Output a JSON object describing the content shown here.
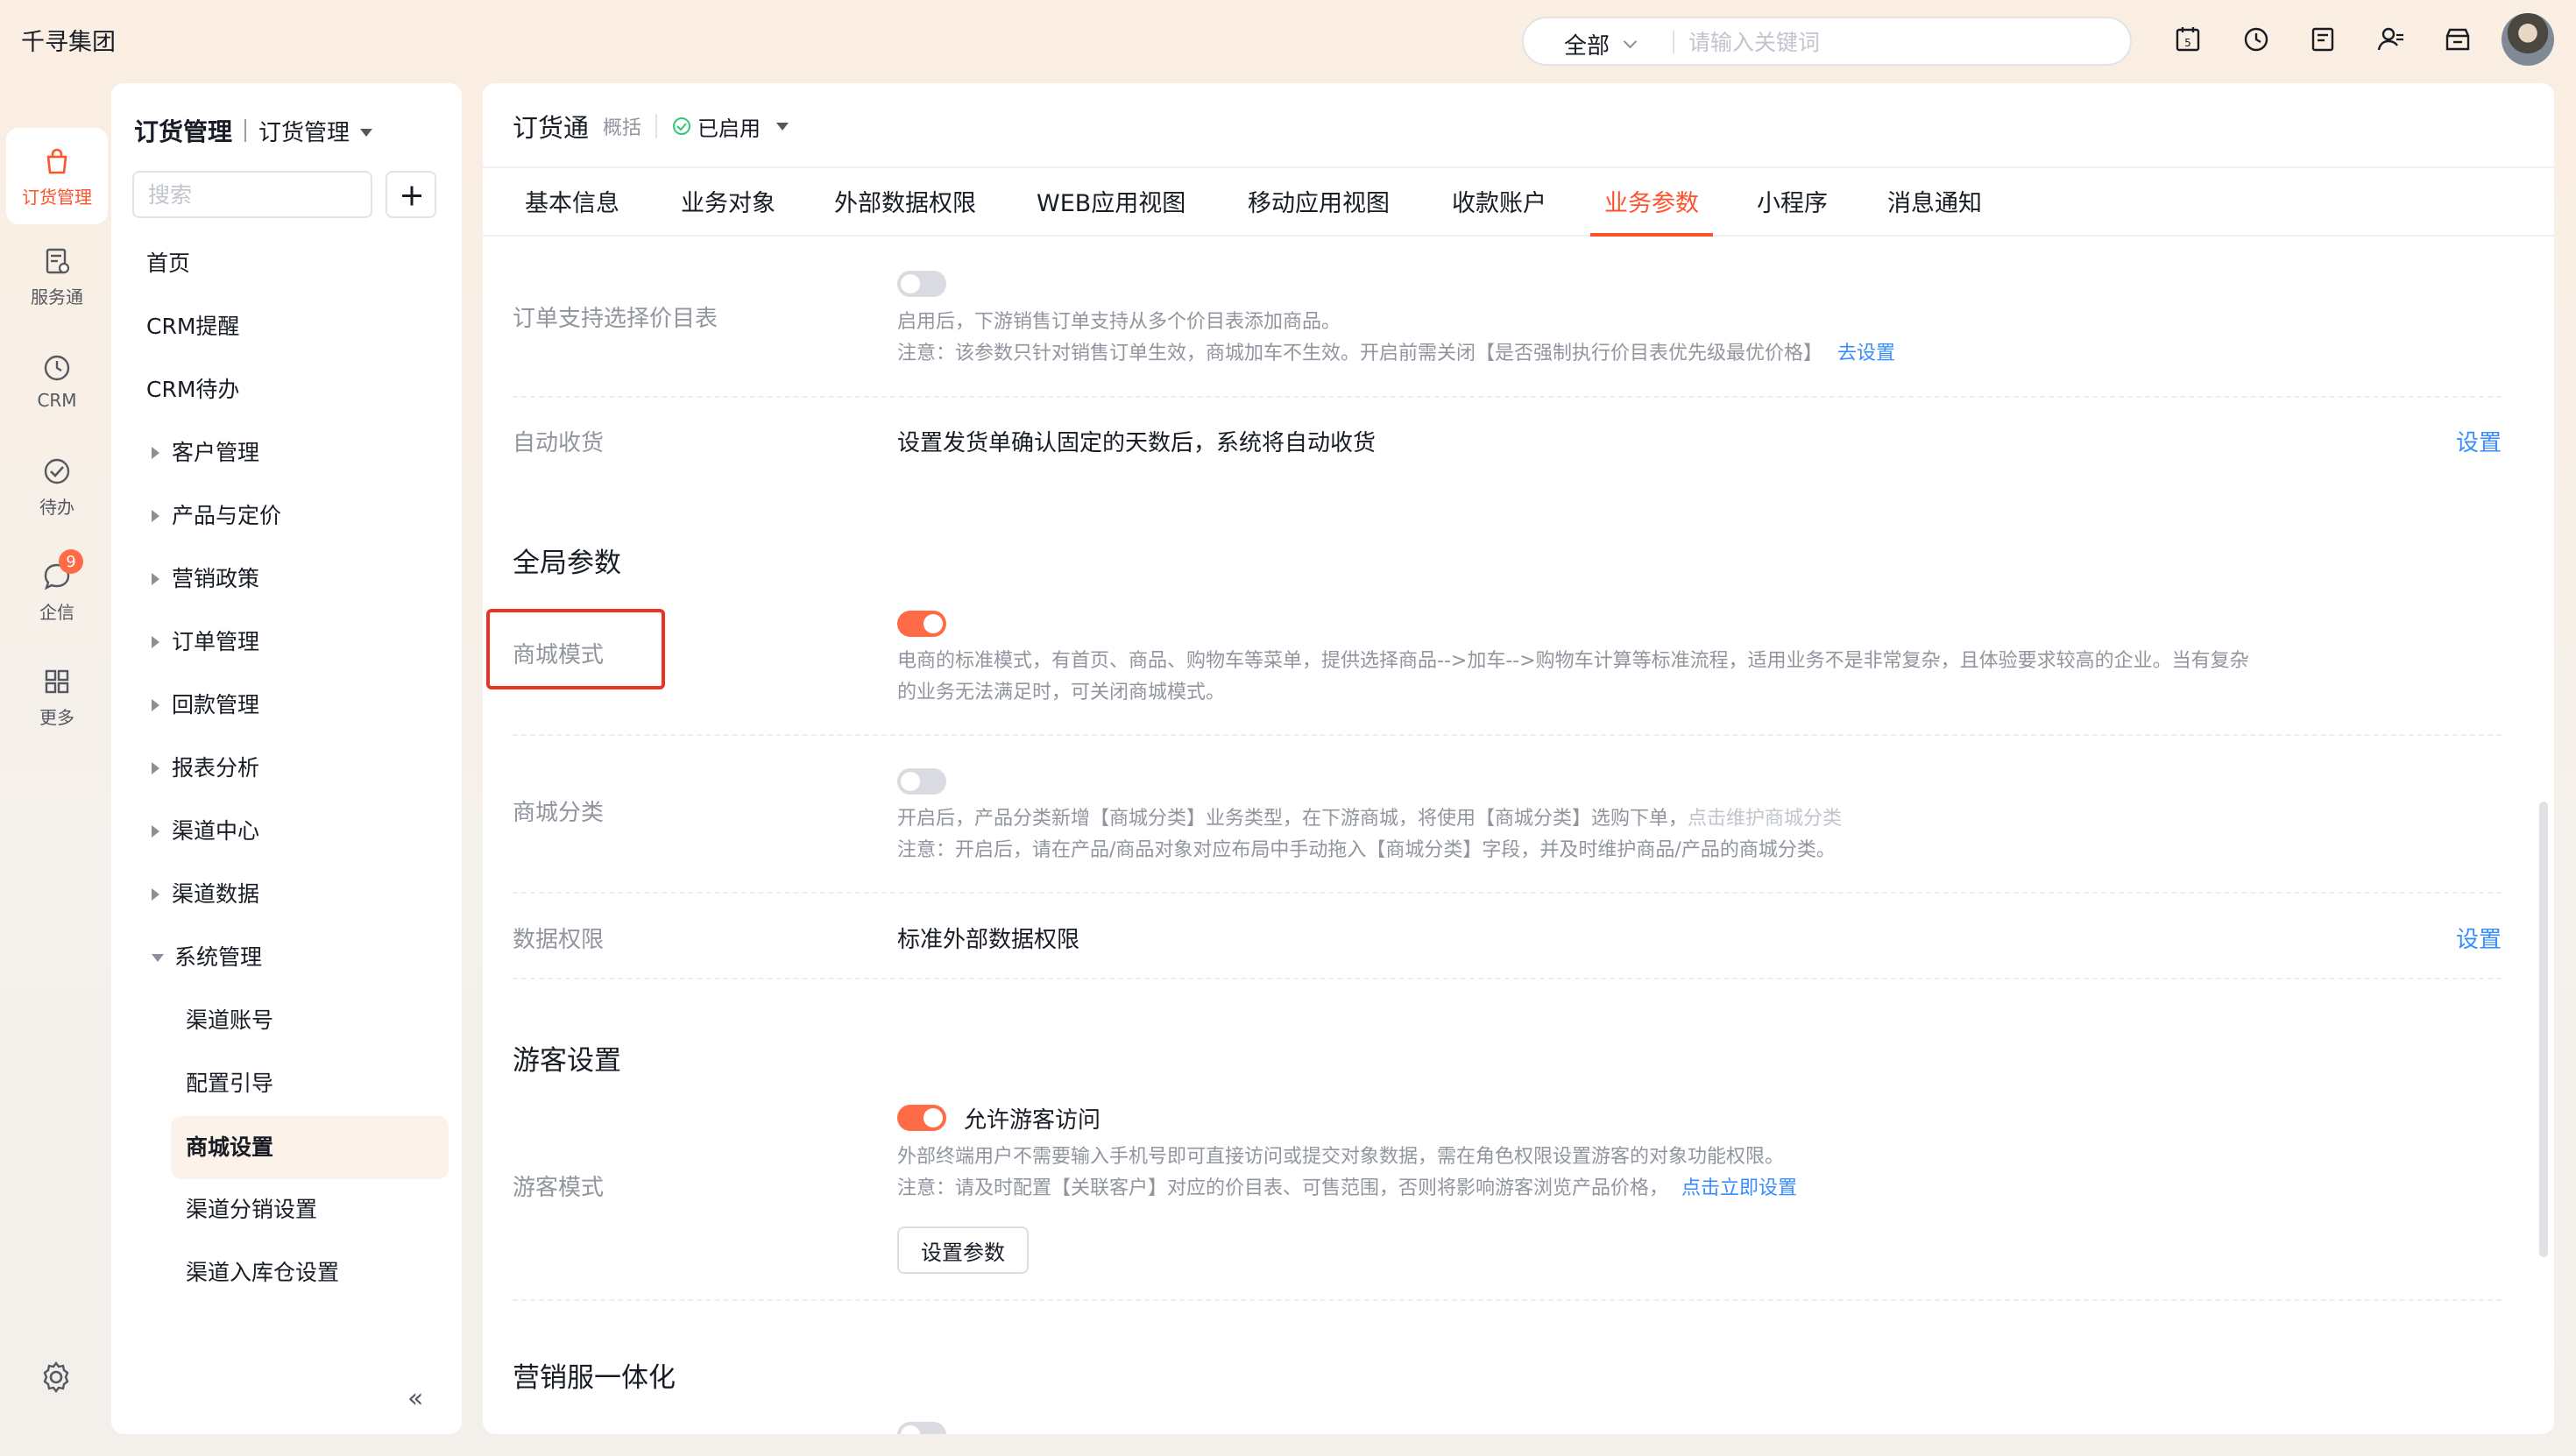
{
  "app": {
    "brand": "千寻集团"
  },
  "topbar": {
    "scope": "全部",
    "search_placeholder": "请输入关键词",
    "icons": [
      "calendar-icon",
      "clock-icon",
      "notebook-icon",
      "user-settings-icon",
      "store-icon"
    ]
  },
  "rail": {
    "items": [
      {
        "label": "订货管理",
        "icon": "bag-icon",
        "active": true
      },
      {
        "label": "服务通",
        "icon": "service-icon"
      },
      {
        "label": "CRM",
        "icon": "clock-icon"
      },
      {
        "label": "待办",
        "icon": "check-circle-icon"
      },
      {
        "label": "企信",
        "icon": "chat-icon",
        "badge": "9"
      },
      {
        "label": "更多",
        "icon": "grid-icon"
      }
    ]
  },
  "nav": {
    "title": "订货管理",
    "subtitle": "订货管理",
    "search_placeholder": "搜索",
    "items": [
      {
        "label": "首页"
      },
      {
        "label": "CRM提醒"
      },
      {
        "label": "CRM待办"
      },
      {
        "label": "客户管理"
      },
      {
        "label": "产品与定价"
      },
      {
        "label": "营销政策"
      },
      {
        "label": "订单管理"
      },
      {
        "label": "回款管理"
      },
      {
        "label": "报表分析"
      },
      {
        "label": "渠道中心"
      },
      {
        "label": "渠道数据"
      },
      {
        "label": "系统管理"
      }
    ],
    "sub_items": [
      {
        "label": "渠道账号"
      },
      {
        "label": "配置引导"
      },
      {
        "label": "商城设置"
      },
      {
        "label": "渠道分销设置"
      },
      {
        "label": "渠道入库仓设置"
      }
    ]
  },
  "main": {
    "title": "订货通",
    "hint": "概括",
    "status": "已启用",
    "tabs": [
      "基本信息",
      "业务对象",
      "外部数据权限",
      "WEB应用视图",
      "移动应用视图",
      "收款账户",
      "业务参数",
      "小程序",
      "消息通知"
    ],
    "active_tab": "业务参数",
    "rows": {
      "price_list": {
        "label": "订单支持选择价目表",
        "enabled": false,
        "desc1": "启用后，下游销售订单支持从多个价目表添加商品。",
        "desc2": "注意：该参数只针对销售订单生效，商城加车不生效。开启前需关闭【是否强制执行价目表优先级最优价格】",
        "link": "去设置"
      },
      "auto_receive": {
        "label": "自动收货",
        "value": "设置发货单确认固定的天数后，系统将自动收货",
        "link": "设置"
      },
      "global_title": "全局参数",
      "mall_mode": {
        "label": "商城模式",
        "enabled": true,
        "desc1": "电商的标准模式，有首页、商品、购物车等菜单，提供选择商品-->加车-->购物车计算等标准流程，适用业务不是非常复杂，且体验要求较高的企业。当有复杂",
        "desc2": "的业务无法满足时，可关闭商城模式。"
      },
      "mall_category": {
        "label": "商城分类",
        "enabled": false,
        "desc1": "开启后，产品分类新增【商城分类】业务类型，在下游商城，将使用【商城分类】选购下单，",
        "desc1_link": "点击维护商城分类",
        "desc2": "注意：开启后，请在产品/商品对象对应布局中手动拖入【商城分类】字段，并及时维护商品/产品的商城分类。"
      },
      "data_perm": {
        "label": "数据权限",
        "value": "标准外部数据权限",
        "link": "设置"
      },
      "guest_title": "游客设置",
      "guest_mode": {
        "label": "游客模式",
        "enabled": true,
        "toggle_label": "允许游客访问",
        "desc1": "外部终端用户不需要输入手机号即可直接访问或提交对象数据，需在角色权限设置游客的对象功能权限。",
        "desc2": "注意：请及时配置【关联客户】对应的价目表、可售范围，否则将影响游客浏览产品价格，",
        "link": "点击立即设置",
        "button": "设置参数"
      },
      "marketing_title": "营销服一体化"
    }
  },
  "colors": {
    "accent": "#ff522a",
    "link": "#368dff",
    "highlight_box": "#ea3323"
  }
}
